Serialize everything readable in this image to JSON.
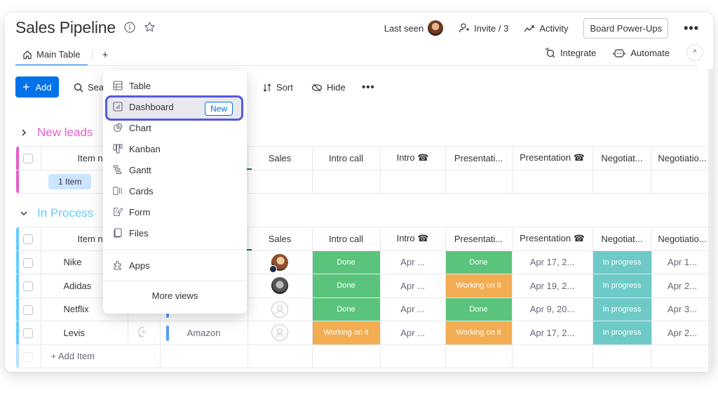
{
  "header": {
    "title": "Sales Pipeline",
    "last_seen_label": "Last seen",
    "invite_label": "Invite / 3",
    "activity_label": "Activity",
    "power_ups_label": "Board Power-Ups",
    "more_label": "•••"
  },
  "tabs": {
    "main_table": "Main Table",
    "add": "+"
  },
  "integrations": {
    "integrate": "Integrate",
    "automate": "Automate",
    "collapse": "^"
  },
  "toolbar": {
    "add": "Add",
    "search": "Sea",
    "sort": "Sort",
    "hide": "Hide",
    "more": "•••"
  },
  "views_menu": {
    "items": [
      {
        "label": "Table",
        "icon": "table-icon"
      },
      {
        "label": "Dashboard",
        "icon": "dashboard-icon",
        "badge": "New",
        "highlighted": true
      },
      {
        "label": "Chart",
        "icon": "chart-icon"
      },
      {
        "label": "Kanban",
        "icon": "kanban-icon"
      },
      {
        "label": "Gantt",
        "icon": "gantt-icon"
      },
      {
        "label": "Cards",
        "icon": "cards-icon"
      },
      {
        "label": "Form",
        "icon": "form-icon"
      },
      {
        "label": "Files",
        "icon": "files-icon"
      }
    ],
    "apps": "Apps",
    "more_views": "More views"
  },
  "columns": [
    "Item n",
    "Sales",
    "Intro call",
    "Intro ☎",
    "Presentati...",
    "Presentation ☎",
    "Negotiat...",
    "Negotiatio..."
  ],
  "groups": [
    {
      "title": "New leads",
      "color": "#e55fc7",
      "collapsed": true,
      "summary": "1 Item"
    },
    {
      "title": "In Process",
      "color": "#66ccff",
      "collapsed": false,
      "rows": [
        {
          "name": "Nike",
          "sales": "avatar-1",
          "intro_call": "Done",
          "intro_date": "Apr ...",
          "presentation": "Done",
          "presentation_date": "Apr 17, 2...",
          "negotiation": "In progress",
          "negotiation_date": "Apr 1..."
        },
        {
          "name": "Adidas",
          "sales": "avatar-2",
          "intro_call": "Done",
          "intro_date": "Apr ...",
          "presentation": "Working on it",
          "presentation_date": "Apr 19, 2...",
          "negotiation": "In progress",
          "negotiation_date": "Apr 2..."
        },
        {
          "name": "Netflix",
          "sales": "empty",
          "intro_call": "Done",
          "intro_date": "Apr ...",
          "presentation": "Done",
          "presentation_date": "Apr 9, 20...",
          "negotiation": "In progress",
          "negotiation_date": "Apr 3..."
        },
        {
          "name": "Levis",
          "sales": "empty",
          "source": "Amazon",
          "intro_call": "Working on it",
          "intro_date": "Apr ...",
          "presentation": "Working on it",
          "presentation_date": "Apr 17, 2...",
          "negotiation": "In progress",
          "negotiation_date": "Apr 2..."
        }
      ],
      "add_item": "+ Add Item"
    }
  ],
  "status_colors": {
    "Done": "#5bc47c",
    "Working on it": "#f2ac52",
    "In progress": "#6ecac6"
  },
  "accent": "#0073ea"
}
